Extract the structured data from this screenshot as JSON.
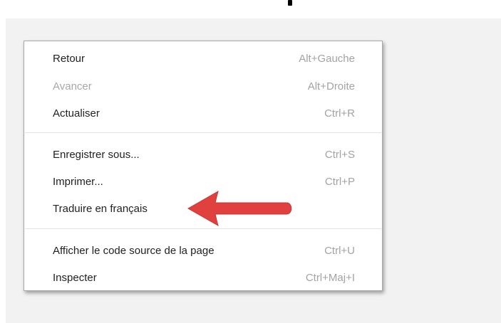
{
  "context_menu": {
    "items": [
      {
        "label": "Retour",
        "shortcut": "Alt+Gauche",
        "enabled": true
      },
      {
        "label": "Avancer",
        "shortcut": "Alt+Droite",
        "enabled": false
      },
      {
        "label": "Actualiser",
        "shortcut": "Ctrl+R",
        "enabled": true
      },
      {
        "label": "Enregistrer sous...",
        "shortcut": "Ctrl+S",
        "enabled": true
      },
      {
        "label": "Imprimer...",
        "shortcut": "Ctrl+P",
        "enabled": true
      },
      {
        "label": "Traduire en français",
        "shortcut": "",
        "enabled": true
      },
      {
        "label": "Afficher le code source de la page",
        "shortcut": "Ctrl+U",
        "enabled": true
      },
      {
        "label": "Inspecter",
        "shortcut": "Ctrl+Maj+I",
        "enabled": true
      }
    ]
  },
  "annotation": {
    "arrow_color": "#e0413f",
    "points_to": "Traduire en français"
  },
  "colors": {
    "menu_background": "#ffffff",
    "page_background": "#f2f2f2",
    "label_text": "#222222",
    "disabled_text": "#a7a7a7",
    "shortcut_text": "#a3a3a3"
  }
}
